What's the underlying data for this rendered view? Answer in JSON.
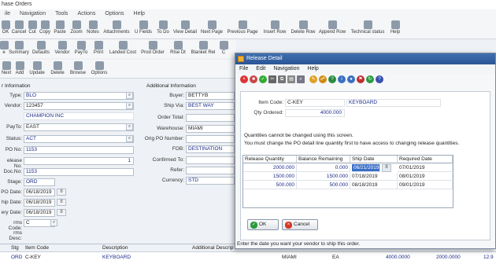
{
  "window": {
    "title": "hase Orders"
  },
  "menubar": [
    "ile",
    "Navigation",
    "Tools",
    "Actions",
    "Options",
    "Help"
  ],
  "toolbar1": [
    {
      "label": "OK",
      "icon": "check-icon"
    },
    {
      "label": "Cancel",
      "icon": "cancel-icon"
    },
    {
      "label": "Cut",
      "icon": "scissors-icon"
    },
    {
      "label": "Copy",
      "icon": "copy-icon"
    },
    {
      "label": "Paste",
      "icon": "paste-icon"
    },
    {
      "label": "Zoom",
      "icon": "zoom-icon"
    },
    {
      "label": "Notes",
      "icon": "notes-icon"
    },
    {
      "label": "Attachments",
      "icon": "paperclip-icon"
    },
    {
      "label": "U Fields",
      "icon": "fields-icon"
    },
    {
      "label": "To Do",
      "icon": "todo-icon"
    },
    {
      "label": "View Detail",
      "icon": "detail-icon"
    },
    {
      "label": "Next Page",
      "icon": "next-page-icon"
    },
    {
      "label": "Previous Page",
      "icon": "prev-page-icon"
    },
    {
      "label": "Insert Row",
      "icon": "insert-row-icon"
    },
    {
      "label": "Delete Row",
      "icon": "delete-row-icon"
    },
    {
      "label": "Append Row",
      "icon": "append-row-icon"
    },
    {
      "label": "Technical status",
      "icon": "tech-status-icon"
    },
    {
      "label": "Help",
      "icon": "help-icon"
    }
  ],
  "toolbar2": [
    {
      "label": "e",
      "icon": "home-icon"
    },
    {
      "label": "Summary",
      "icon": "summary-icon"
    },
    {
      "label": "Defaults",
      "icon": "defaults-icon"
    },
    {
      "label": "Vendor",
      "icon": "vendor-icon"
    },
    {
      "label": "PayTo",
      "icon": "payto-icon"
    },
    {
      "label": "Print",
      "icon": "print-icon"
    },
    {
      "label": "Landed Cost",
      "icon": "landed-cost-icon"
    },
    {
      "label": "Prod Order",
      "icon": "prod-order-icon"
    },
    {
      "label": "Rlse Dt",
      "icon": "release-date-icon"
    },
    {
      "label": "Blanket Rel",
      "icon": "blanket-icon"
    },
    {
      "label": "C",
      "icon": "more-icon"
    }
  ],
  "toolbar3": [
    {
      "label": "Next",
      "icon": "next-icon"
    },
    {
      "label": "Add",
      "icon": "add-icon"
    },
    {
      "label": "Update",
      "icon": "update-icon"
    },
    {
      "label": "Delete",
      "icon": "delete-icon"
    },
    {
      "label": "Browse",
      "icon": "browse-icon"
    },
    {
      "label": "Options",
      "icon": "options-icon"
    }
  ],
  "header_left": {
    "section": "r Information",
    "type_label": "Type:",
    "type": "BLO",
    "vendor_label": "Vendor:",
    "vendor": "123457",
    "vendor_name": "CHAMPION INC",
    "payto_label": "PayTo:",
    "payto": "EAST",
    "status_label": "Status:",
    "status": "ACT",
    "pono_label": "PO No:",
    "pono": "1153",
    "release_label": "elease No:",
    "release": "1",
    "docno_label": "Doc.No:",
    "docno": "1153",
    "stage_label": "Stage:",
    "stage": "ORD",
    "podate_label": "PO Date:",
    "podate": "06/18/2019",
    "shipdate_label": "hip Date:",
    "shipdate": "06/18/2019",
    "delivery_label": "ery Date:",
    "delivery": "06/18/2019",
    "terms_label": "rms Code:",
    "terms": "C",
    "termsdesc_label": "rms Desc:",
    "cal": "8"
  },
  "header_mid": {
    "section": "Additional Information",
    "buyer_label": "Buyer:",
    "buyer": "BETTYB",
    "shipvia_label": "Ship Via:",
    "shipvia": "BEST WAY",
    "ordertotal_label": "Order Total:",
    "warehouse_label": "Warehouse:",
    "warehouse": "MIAMI",
    "origpo_label": "Orig PO Number:",
    "fob_label": "FOB:",
    "fob": "DESTINATION",
    "confirmed_label": "Confirmed To:",
    "refer_label": "Refer:",
    "currency_label": "Currency:",
    "currency": "STD"
  },
  "grid": {
    "headers": [
      "Stg",
      "Item Code",
      "Description",
      "Additional Descrip"
    ],
    "row": {
      "stg": "ORD",
      "item": "C-KEY",
      "desc": "KEYBOARD",
      "wh": "MIAMI",
      "um": "EA",
      "qty": "4000.0000",
      "qty2": "2000.0000",
      "amt": "12.9"
    }
  },
  "dialog": {
    "title": "Release Detail",
    "menu": [
      "File",
      "Edit",
      "Navigation",
      "Help"
    ],
    "item_label": "Item Code:",
    "item_code": "C-KEY",
    "item_desc": "KEYBOARD",
    "qty_label": "Qty Ordered:",
    "qty": "4000.000",
    "msg1": "Quantities cannot be changed using this screen.",
    "msg2": "You must change the PO detail line quantity first to have access to changing release quantities.",
    "columns": [
      "Release Quantity",
      "Balance Remaining",
      "Ship Date",
      "Required Date"
    ],
    "rows": [
      {
        "qty": "2000.000",
        "bal": "0.000",
        "ship": "06/21/2019",
        "req": "07/01/2019"
      },
      {
        "qty": "1500.000",
        "bal": "1500.000",
        "ship": "07/18/2019",
        "req": "08/01/2019"
      },
      {
        "qty": "500.000",
        "bal": "500.000",
        "ship": "08/18/2019",
        "req": "09/01/2019"
      }
    ],
    "ok": "OK",
    "cancel": "Cancel",
    "status": "Enter the date you want your vendor to ship this order."
  }
}
